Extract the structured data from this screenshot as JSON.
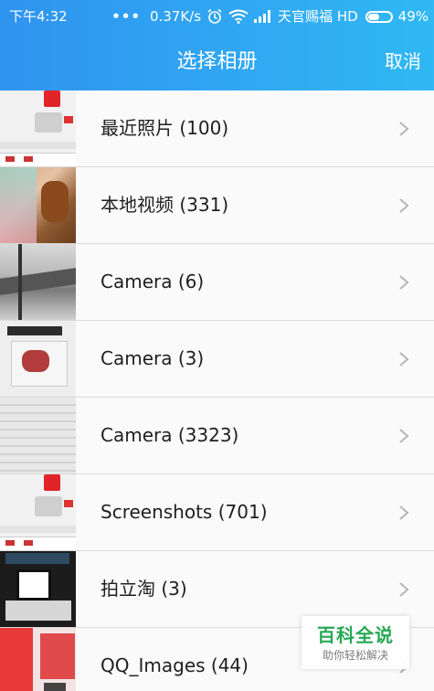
{
  "status_bar": {
    "time": "下午4:32",
    "network_speed": "0.37K/s",
    "carrier": "天官赐福 HD",
    "battery": "49%",
    "battery_level": 0.49
  },
  "header": {
    "title": "选择相册",
    "cancel_label": "取消"
  },
  "albums": [
    {
      "label": "最近照片 (100)",
      "thumb": "screenshot"
    },
    {
      "label": "本地视频 (331)",
      "thumb": "baby"
    },
    {
      "label": "Camera (6)",
      "thumb": "roof"
    },
    {
      "label": "Camera (3)",
      "thumb": "hair-dryer"
    },
    {
      "label": "Camera (3323)",
      "thumb": "document"
    },
    {
      "label": "Screenshots (701)",
      "thumb": "screenshot"
    },
    {
      "label": "拍立淘 (3)",
      "thumb": "poster"
    },
    {
      "label": "QQ_Images (44)",
      "thumb": "red-banner"
    }
  ],
  "watermark": {
    "title": "百科全说",
    "subtitle": "助你轻松解决"
  },
  "colors": {
    "header_start": "#2f93f0",
    "header_end": "#30b8f3",
    "list_bg": "#fafafa",
    "watermark_green": "#27a853"
  }
}
